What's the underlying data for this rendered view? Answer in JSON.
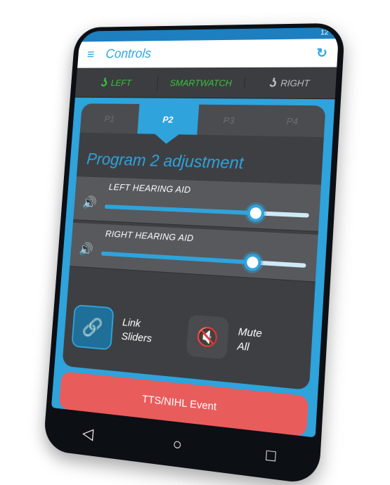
{
  "status": {
    "time": "12"
  },
  "appbar": {
    "menu_icon": "≡",
    "title": "Controls",
    "refresh_icon": "↻"
  },
  "devices": {
    "left": {
      "icon": "ʖ",
      "label": "LEFT"
    },
    "smartwatch": {
      "label": "SMARTWATCH"
    },
    "right": {
      "icon": "ʖ",
      "label": "RIGHT"
    }
  },
  "tabs": [
    {
      "label": "P1"
    },
    {
      "label": "P2"
    },
    {
      "label": "P3"
    },
    {
      "label": "P4"
    }
  ],
  "active_tab": "P2",
  "program_title": "Program 2 adjustment",
  "sliders": {
    "left": {
      "label": "LEFT HEARING AID",
      "icon": "🔊",
      "value": 0.75
    },
    "right": {
      "label": "RIGHT HEARING AID",
      "icon": "🔊",
      "value": 0.75
    }
  },
  "actions": {
    "link": {
      "icon": "🔗",
      "label_line1": "Link",
      "label_line2": "Sliders"
    },
    "mute": {
      "icon": "🔇",
      "label_line1": "Mute",
      "label_line2": "All"
    }
  },
  "event_button": {
    "label": "TTS/NIHL Event"
  },
  "navbar": {
    "back": "◁",
    "home": "○",
    "recent": "□"
  },
  "colors": {
    "accent": "#2ea3dc",
    "device_active": "#39c33f",
    "event": "#e85c5c",
    "panel": "#3e3f42"
  }
}
